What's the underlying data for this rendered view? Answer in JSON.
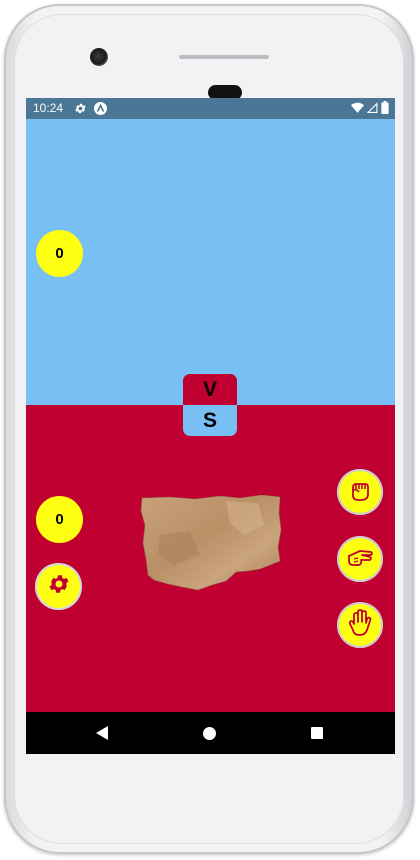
{
  "status_bar": {
    "time": "10:24",
    "icons": [
      "settings-gear-icon",
      "app-badge-icon",
      "wifi-icon",
      "signal-icon",
      "battery-icon"
    ]
  },
  "game": {
    "opponent": {
      "score": "0"
    },
    "player": {
      "score": "0"
    },
    "vs_badge": {
      "top_letter": "V",
      "bottom_letter": "S"
    },
    "choices": [
      {
        "name": "rock",
        "icon": "fist-icon"
      },
      {
        "name": "scissors",
        "icon": "scissors-hand-icon"
      },
      {
        "name": "paper",
        "icon": "open-hand-icon"
      }
    ],
    "current_throw_icon": "paper-sheet-image",
    "settings_icon": "gear-icon"
  },
  "colors": {
    "top_half": "#78bff3",
    "bottom_half": "#c00030",
    "button_yellow": "#ffff12",
    "status_bar": "#4b7696",
    "nav_bar": "#000000"
  },
  "nav_bar": {
    "buttons": [
      "back-icon",
      "home-icon",
      "recents-icon"
    ]
  }
}
